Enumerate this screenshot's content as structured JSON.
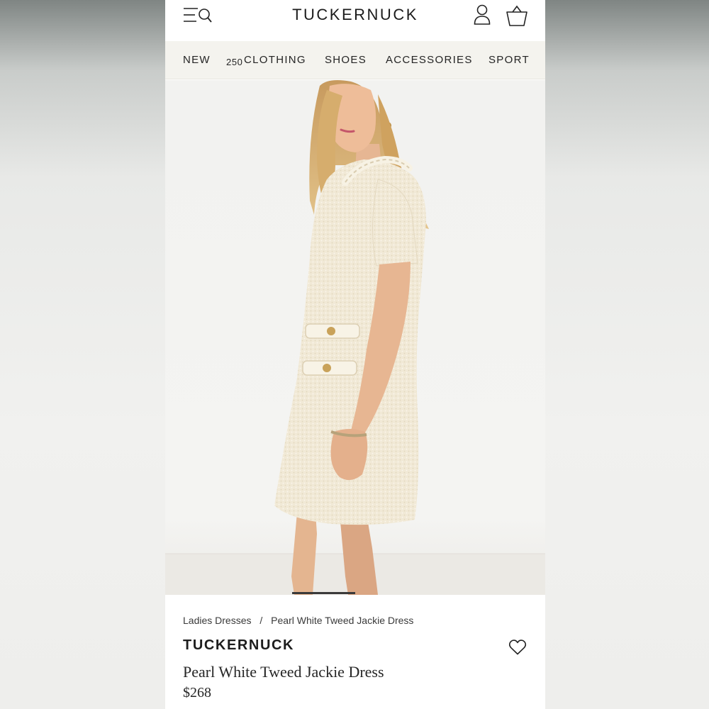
{
  "header": {
    "logo": "TUCKERNUCK",
    "icons": [
      "menu-search-icon",
      "account-icon",
      "shopping-bag-icon"
    ]
  },
  "nav": {
    "items": [
      {
        "label": "NEW",
        "badge": "250"
      },
      {
        "label": "CLOTHING"
      },
      {
        "label": "SHOES"
      },
      {
        "label": "ACCESSORIES"
      },
      {
        "label": "SPORT"
      }
    ]
  },
  "hero": {
    "image_subject": "model wearing a cream tweed short-sleeve shift dress",
    "carousel_active_index": 1
  },
  "product": {
    "breadcrumb": [
      "Ladies Dresses",
      "Pearl White Tweed Jackie Dress"
    ],
    "breadcrumb_separator": "/",
    "brand": "TUCKERNUCK",
    "name": "Pearl White Tweed Jackie Dress",
    "price": "$268",
    "wishlist_icon": "heart-icon"
  },
  "colors": {
    "nav_background": "#f4f3ee",
    "text": "#1d1d1d",
    "dress": "#f1e9d6"
  }
}
